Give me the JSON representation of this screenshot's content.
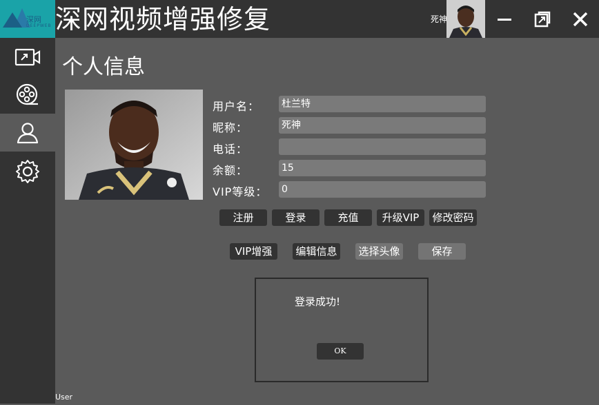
{
  "app": {
    "logo_text": "深网",
    "logo_sub": "DEEPWEB",
    "title": "深网视频增强修复",
    "user_nick": "死神"
  },
  "page": {
    "title": "个人信息"
  },
  "form": {
    "username_label": "用户名：",
    "username_value": "杜兰特",
    "nickname_label": "昵称：",
    "nickname_value": "死神",
    "phone_label": "电话：",
    "phone_value": "",
    "balance_label": "余额：",
    "balance_value": "15",
    "vip_label": "VIP等级：",
    "vip_value": "0"
  },
  "buttons": {
    "register": "注册",
    "login": "登录",
    "recharge": "充值",
    "upgrade_vip": "升级VIP",
    "change_password": "修改密码",
    "vip_enhance": "VIP增强",
    "edit_info": "编辑信息",
    "choose_avatar": "选择头像",
    "save": "保存"
  },
  "dialog": {
    "message": "登录成功!",
    "ok": "OK"
  },
  "status": {
    "text": "User"
  }
}
